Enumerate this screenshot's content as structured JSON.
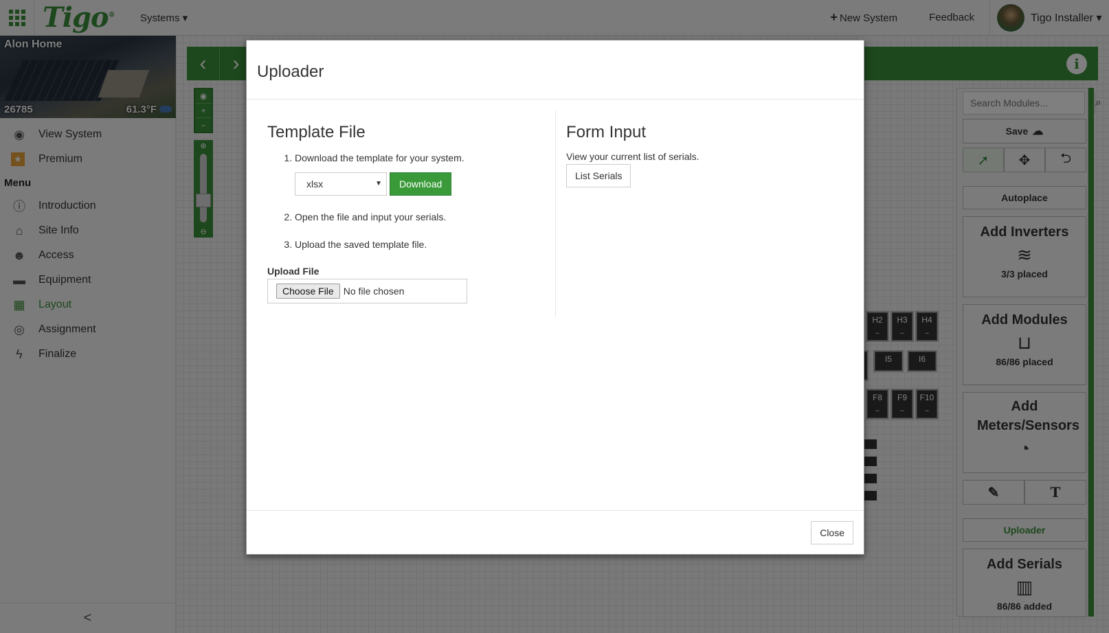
{
  "topbar": {
    "logo": "Tigo",
    "logo_mark": "®",
    "systems": "Systems ▾",
    "new_system": "New System",
    "feedback": "Feedback",
    "user": "Tigo Installer ▾"
  },
  "system": {
    "name": "Alon Home",
    "id": "26785",
    "temp": "61.3°F"
  },
  "sidebar": {
    "top_items": [
      {
        "label": "View System",
        "icon": "eye-icon"
      },
      {
        "label": "Premium",
        "icon": "star-icon"
      }
    ],
    "menu_label": "Menu",
    "items": [
      {
        "label": "Introduction",
        "icon": "info-icon"
      },
      {
        "label": "Site Info",
        "icon": "home-icon"
      },
      {
        "label": "Access",
        "icon": "users-icon"
      },
      {
        "label": "Equipment",
        "icon": "briefcase-icon"
      },
      {
        "label": "Layout",
        "icon": "blocks-icon",
        "active": true
      },
      {
        "label": "Assignment",
        "icon": "signal-icon"
      },
      {
        "label": "Finalize",
        "icon": "bolt-icon"
      }
    ],
    "collapse": "<"
  },
  "canvas": {
    "modules_row1": [
      "H2",
      "H3",
      "H4"
    ],
    "modules_row2": [
      "I5",
      "I6"
    ],
    "modules_row3": [
      "F8",
      "F9",
      "F10"
    ]
  },
  "panel": {
    "search_placeholder": "Search Modules...",
    "save": "Save",
    "autoplace": "Autoplace",
    "add_inverters": "Add Inverters",
    "inverters_status": "3/3 placed",
    "add_modules": "Add Modules",
    "modules_status": "86/86 placed",
    "add_meters": "Add Meters/Sensors",
    "uploader": "Uploader",
    "add_serials": "Add Serials",
    "serials_status": "86/86 added"
  },
  "modal": {
    "title": "Uploader",
    "template_title": "Template File",
    "steps": [
      "Download the template for your system.",
      "Open the file and input your serials.",
      "Upload the saved template file."
    ],
    "format_value": "xlsx",
    "download": "Download",
    "upload_label": "Upload File",
    "choose_file": "Choose File",
    "no_file": "No file chosen",
    "form_title": "Form Input",
    "form_desc": "View your current list of serials.",
    "list_serials": "List Serials",
    "close": "Close"
  },
  "colors": {
    "brand_green": "#3a8f3a"
  }
}
